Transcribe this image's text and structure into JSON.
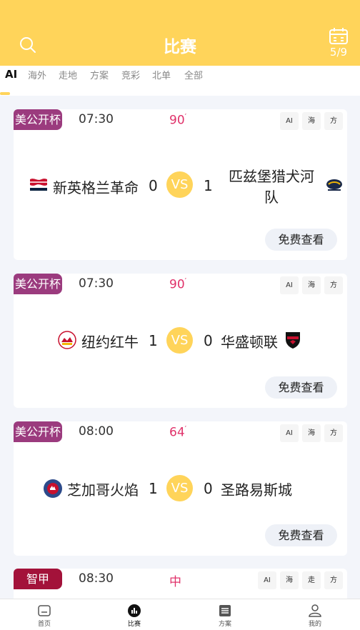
{
  "header": {
    "title": "比赛",
    "date": "5/9"
  },
  "tabs": [
    "AI",
    "海外",
    "走地",
    "方案",
    "竞彩",
    "北单",
    "全部"
  ],
  "matches": [
    {
      "league": "美公开杯",
      "league_color": "#9b3b7e",
      "time": "07:30",
      "minute": "90",
      "minute_mark": "′",
      "chips": [
        "AI",
        "海",
        "方"
      ],
      "home": "新英格兰革命",
      "home_score": "0",
      "vs": "VS",
      "away_score": "1",
      "away": "匹兹堡猎犬河队",
      "button": "免费查看"
    },
    {
      "league": "美公开杯",
      "league_color": "#9b3b7e",
      "time": "07:30",
      "minute": "90",
      "minute_mark": "′",
      "chips": [
        "AI",
        "海",
        "方"
      ],
      "home": "纽约红牛",
      "home_score": "1",
      "vs": "VS",
      "away_score": "0",
      "away": "华盛顿联",
      "button": "免费查看"
    },
    {
      "league": "美公开杯",
      "league_color": "#9b3b7e",
      "time": "08:00",
      "minute": "64",
      "minute_mark": "′",
      "chips": [
        "AI",
        "海",
        "方"
      ],
      "home": "芝加哥火焰",
      "home_score": "1",
      "vs": "VS",
      "away_score": "0",
      "away": "圣路易斯城",
      "button": "免费查看"
    },
    {
      "league": "智甲",
      "league_color": "#a3123a",
      "time": "08:30",
      "minute": "中",
      "minute_mark": "",
      "chips": [
        "AI",
        "海",
        "走",
        "方"
      ]
    }
  ],
  "bottom_nav": [
    {
      "label": "首页",
      "icon": "home-icon"
    },
    {
      "label": "比赛",
      "icon": "match-icon"
    },
    {
      "label": "方案",
      "icon": "list-icon"
    },
    {
      "label": "我的",
      "icon": "user-icon"
    }
  ],
  "colors": {
    "accent": "#ffd45a",
    "live_minute": "#e0326a",
    "league_purple": "#9b3b7e",
    "league_red": "#a3123a"
  },
  "icons": [
    "search-icon",
    "calendar-icon"
  ]
}
